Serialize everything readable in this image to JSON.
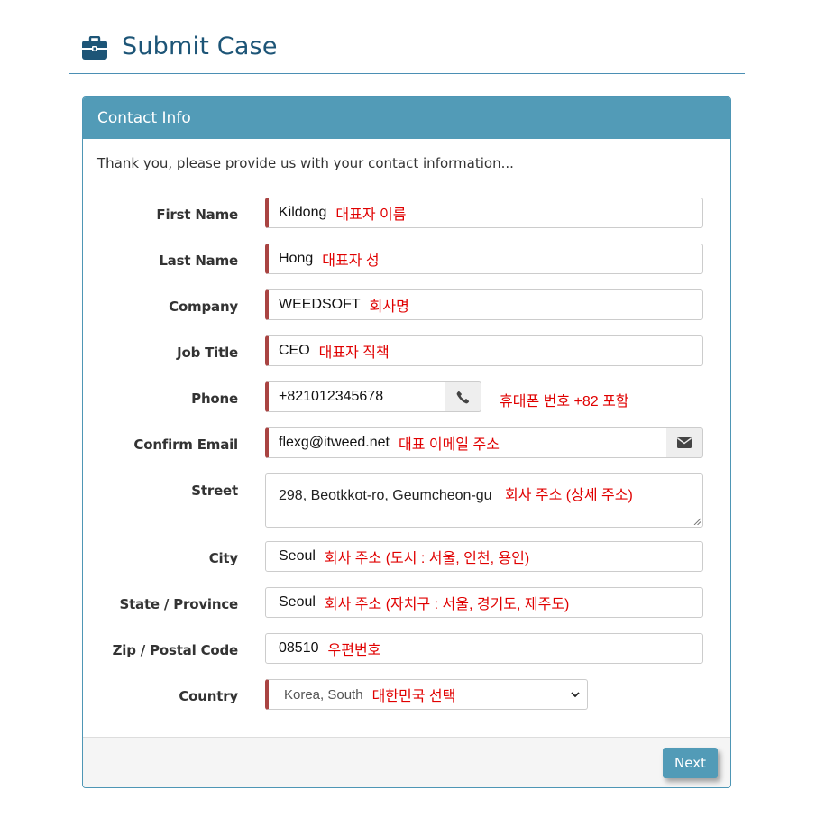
{
  "header": {
    "title": "Submit Case",
    "icon": "briefcase-icon"
  },
  "panel": {
    "heading": "Contact Info",
    "intro": "Thank you, please provide us with your contact information..."
  },
  "fields": {
    "first_name": {
      "label": "First Name",
      "value": "Kildong",
      "note": "대표자 이름"
    },
    "last_name": {
      "label": "Last Name",
      "value": "Hong",
      "note": "대표자 성"
    },
    "company": {
      "label": "Company",
      "value": "WEEDSOFT",
      "note": "회사명"
    },
    "job_title": {
      "label": "Job Title",
      "value": "CEO",
      "note": "대표자 직책"
    },
    "phone": {
      "label": "Phone",
      "value": "+821012345678",
      "note": "휴대폰 번호 +82 포함",
      "icon": "phone-icon"
    },
    "confirm_email": {
      "label": "Confirm Email",
      "value": "flexg@itweed.net",
      "note": "대표 이메일 주소",
      "icon": "envelope-icon"
    },
    "street": {
      "label": "Street",
      "value": "298, Beotkkot-ro, Geumcheon-gu",
      "note": "회사 주소 (상세 주소)"
    },
    "city": {
      "label": "City",
      "value": "Seoul",
      "note": "회사 주소 (도시 : 서울, 인천, 용인)"
    },
    "state": {
      "label": "State / Province",
      "value": "Seoul",
      "note": "회사 주소 (자치구 : 서울, 경기도, 제주도)"
    },
    "zip": {
      "label": "Zip / Postal Code",
      "value": "08510",
      "note": "우편번호"
    },
    "country": {
      "label": "Country",
      "value": "Korea, South",
      "note": "대한민국 선택"
    }
  },
  "footer": {
    "next_label": "Next"
  },
  "colors": {
    "primary": "#529bb7",
    "title": "#1d5577",
    "required_marker": "#a94442",
    "note": "#e00000"
  }
}
